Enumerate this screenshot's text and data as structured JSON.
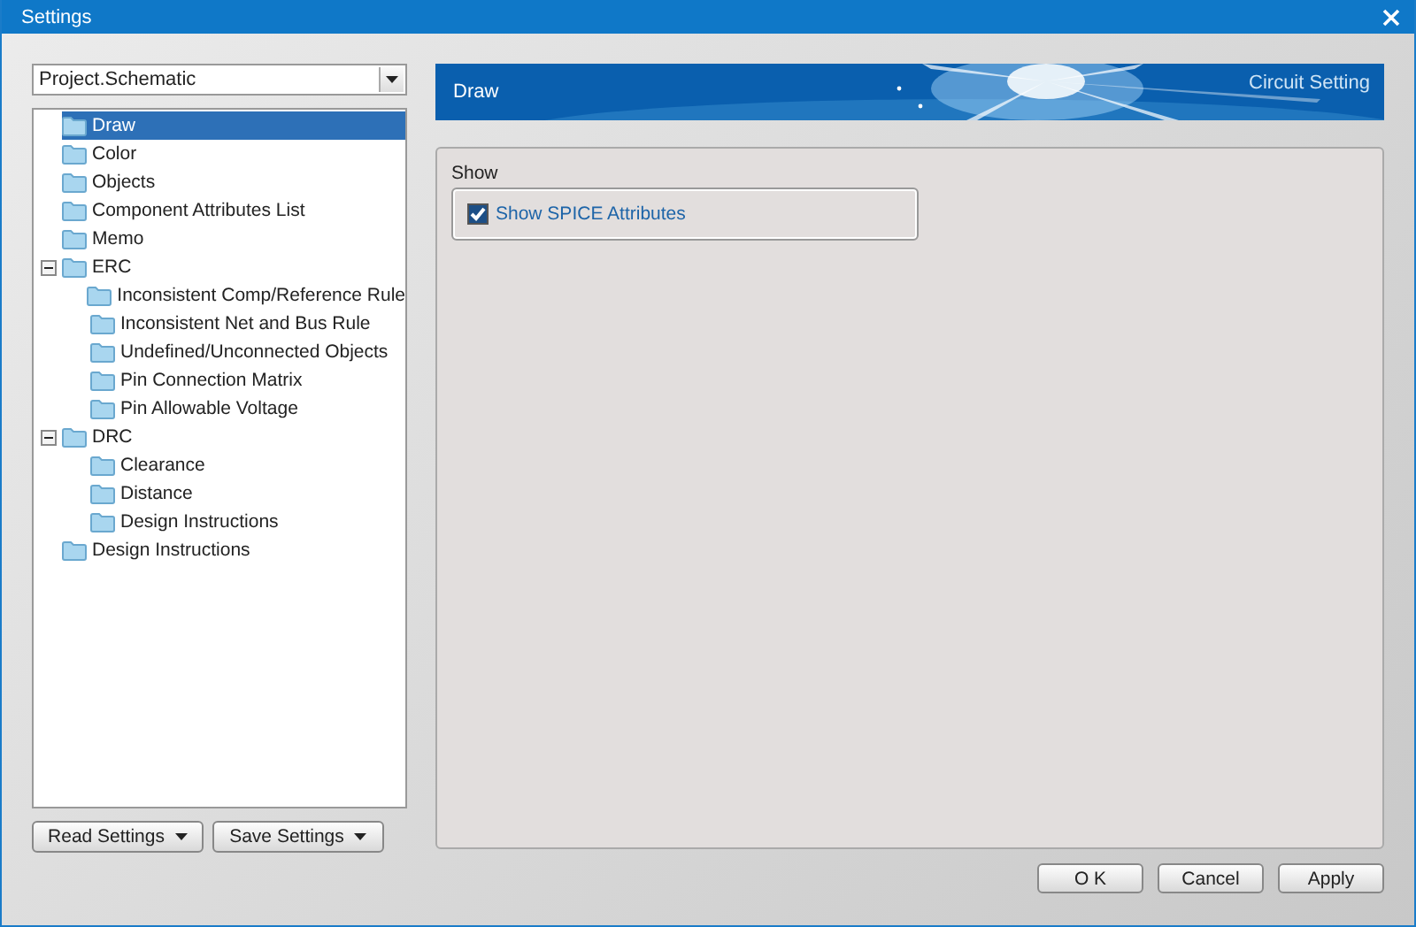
{
  "window": {
    "title": "Settings"
  },
  "profile": {
    "value": "Project.Schematic"
  },
  "tree": [
    {
      "label": "Draw",
      "selected": true
    },
    {
      "label": "Color",
      "selected": false
    },
    {
      "label": "Objects",
      "selected": false
    },
    {
      "label": "Component Attributes List",
      "selected": false
    },
    {
      "label": "Memo",
      "selected": false
    },
    {
      "label": "ERC",
      "selected": false,
      "expanded": true,
      "children": [
        {
          "label": "Inconsistent Comp/Reference Rule",
          "selected": false
        },
        {
          "label": "Inconsistent Net and Bus Rule",
          "selected": false
        },
        {
          "label": "Undefined/Unconnected Objects",
          "selected": false
        },
        {
          "label": "Pin Connection Matrix",
          "selected": false
        },
        {
          "label": "Pin Allowable Voltage",
          "selected": false
        }
      ]
    },
    {
      "label": "DRC",
      "selected": false,
      "expanded": true,
      "children": [
        {
          "label": "Clearance",
          "selected": false
        },
        {
          "label": "Distance",
          "selected": false
        },
        {
          "label": "Design Instructions",
          "selected": false
        }
      ]
    },
    {
      "label": "Design Instructions",
      "selected": false
    }
  ],
  "left_buttons": [
    "Read Settings",
    "Save Settings"
  ],
  "banner": {
    "title": "Draw",
    "subtitle": "Circuit Setting"
  },
  "group": {
    "title": "Show",
    "options": [
      {
        "label": "Show SPICE Attributes",
        "checked": true
      }
    ]
  },
  "buttons": [
    "O K",
    "Cancel",
    "Apply"
  ]
}
